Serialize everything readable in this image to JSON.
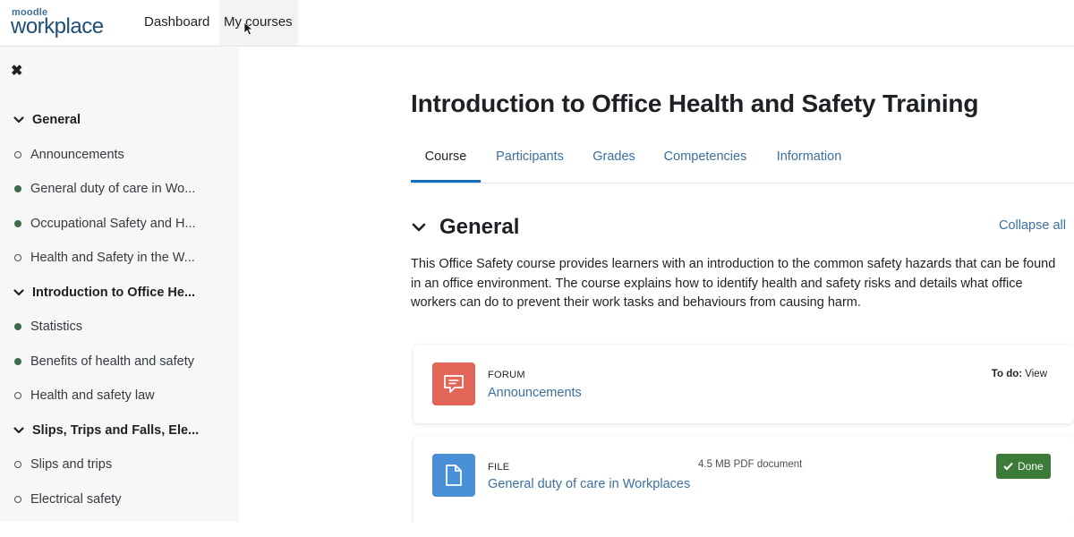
{
  "brand": {
    "small": "moodle",
    "big": "workplace"
  },
  "nav": {
    "dashboard": "Dashboard",
    "my_courses": "My courses"
  },
  "sidebar": {
    "items": [
      {
        "label": "General",
        "kind": "section"
      },
      {
        "label": "Announcements",
        "kind": "empty"
      },
      {
        "label": "General duty of care in Wo...",
        "kind": "filled"
      },
      {
        "label": "Occupational Safety and H...",
        "kind": "filled"
      },
      {
        "label": "Health and Safety in the W...",
        "kind": "empty"
      },
      {
        "label": "Introduction to Office He...",
        "kind": "section"
      },
      {
        "label": "Statistics",
        "kind": "filled"
      },
      {
        "label": "Benefits of health and safety",
        "kind": "filled"
      },
      {
        "label": "Health and safety law",
        "kind": "empty"
      },
      {
        "label": "Slips, Trips and Falls, Ele...",
        "kind": "section"
      },
      {
        "label": "Slips and trips",
        "kind": "empty"
      },
      {
        "label": "Electrical safety",
        "kind": "empty"
      }
    ]
  },
  "course": {
    "title": "Introduction to Office Health and Safety Training",
    "tabs": [
      {
        "label": "Course",
        "active": true
      },
      {
        "label": "Participants",
        "active": false
      },
      {
        "label": "Grades",
        "active": false
      },
      {
        "label": "Competencies",
        "active": false
      },
      {
        "label": "Information",
        "active": false
      }
    ],
    "section_title": "General",
    "collapse_all": "Collapse all",
    "summary": "This Office Safety course provides learners with an introduction to the common safety hazards that can be found in an office environment. The course explains how to identify health and safety risks and details what office workers can do to prevent their work tasks and behaviours from causing harm."
  },
  "activities": [
    {
      "type": "FORUM",
      "name": "Announcements",
      "todo_label": "To do:",
      "todo_value": "View",
      "icon": "forum-icon",
      "icon_color": "#e26557"
    },
    {
      "type": "FILE",
      "name": "General duty of care in Workplaces",
      "meta": "4.5 MB PDF document",
      "status": "Done",
      "icon": "file-icon",
      "icon_color": "#4a90d9",
      "status_color": "#3c7a38"
    }
  ],
  "colors": {
    "link": "#3c6fa0",
    "active_tab": "#0f6cbf",
    "done": "#3c7a38"
  }
}
